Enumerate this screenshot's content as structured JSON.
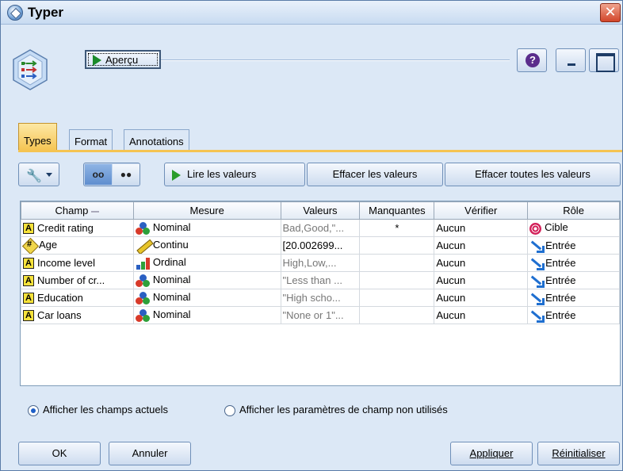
{
  "window": {
    "title": "Typer"
  },
  "header": {
    "preview_label": "Aperçu",
    "help_symbol": "?"
  },
  "tabs": [
    {
      "label": "Types",
      "active": true
    },
    {
      "label": "Format",
      "active": false
    },
    {
      "label": "Annotations",
      "active": false
    }
  ],
  "toolbar": {
    "read_values": "Lire les valeurs",
    "clear_values": "Effacer les valeurs",
    "clear_all_values": "Effacer toutes les valeurs"
  },
  "table": {
    "columns": [
      "Champ",
      "Mesure",
      "Valeurs",
      "Manquantes",
      "Vérifier",
      "Rôle"
    ],
    "rows": [
      {
        "field": "Credit rating",
        "field_icon": "string-icon",
        "measure": "Nominal",
        "measure_icon": "nominal-icon",
        "values": "Bad,Good,\"...",
        "missing": "*",
        "check": "Aucun",
        "role": "Cible",
        "role_icon": "target-icon"
      },
      {
        "field": "Age",
        "field_icon": "numeric-icon",
        "measure": "Continu",
        "measure_icon": "continuous-icon",
        "values": "[20.002699...",
        "missing": "",
        "check": "Aucun",
        "role": "Entrée",
        "role_icon": "input-arrow-icon"
      },
      {
        "field": "Income level",
        "field_icon": "string-icon",
        "measure": "Ordinal",
        "measure_icon": "ordinal-icon",
        "values": "High,Low,...",
        "missing": "",
        "check": "Aucun",
        "role": "Entrée",
        "role_icon": "input-arrow-icon"
      },
      {
        "field": "Number of cr...",
        "field_icon": "string-icon",
        "measure": "Nominal",
        "measure_icon": "nominal-icon",
        "values": "\"Less than ...",
        "missing": "",
        "check": "Aucun",
        "role": "Entrée",
        "role_icon": "input-arrow-icon"
      },
      {
        "field": "Education",
        "field_icon": "string-icon",
        "measure": "Nominal",
        "measure_icon": "nominal-icon",
        "values": "\"High scho...",
        "missing": "",
        "check": "Aucun",
        "role": "Entrée",
        "role_icon": "input-arrow-icon"
      },
      {
        "field": "Car loans",
        "field_icon": "string-icon",
        "measure": "Nominal",
        "measure_icon": "nominal-icon",
        "values": "\"None or 1\"...",
        "missing": "",
        "check": "Aucun",
        "role": "Entrée",
        "role_icon": "input-arrow-icon"
      }
    ]
  },
  "options": {
    "show_current": "Afficher les champs actuels",
    "show_unused": "Afficher les paramètres de champ non utilisés",
    "selected": "show_current"
  },
  "buttons": {
    "ok": "OK",
    "cancel": "Annuler",
    "apply": "Appliquer",
    "reset": "Réinitialiser"
  },
  "colors": {
    "window_bg": "#dce8f6",
    "active_tab": "#f5c452",
    "title_close": "#d2452a"
  }
}
